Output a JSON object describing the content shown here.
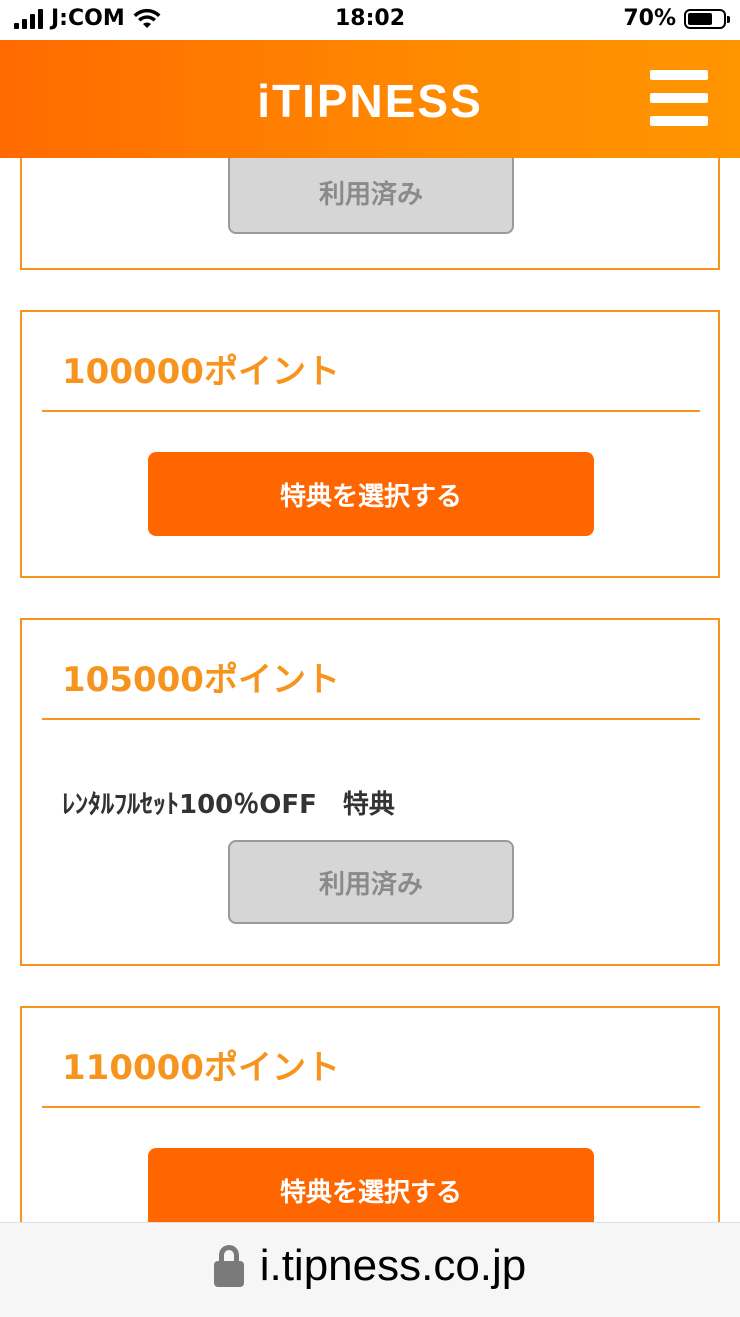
{
  "status_bar": {
    "carrier": "J:COM",
    "time": "18:02",
    "battery": "70%",
    "battery_level": 0.7
  },
  "header": {
    "logo": "iTIPNESS",
    "menu_icon": "hamburger-menu-icon"
  },
  "cards": [
    {
      "button_used": "利用済み"
    },
    {
      "title": "100000ポイント",
      "button_select": "特典を選択する"
    },
    {
      "title": "105000ポイント",
      "benefit": "ﾚﾝﾀﾙﾌﾙｾｯﾄ100％OFF　特典",
      "button_used": "利用済み"
    },
    {
      "title": "110000ポイント",
      "button_select": "特典を選択する"
    }
  ],
  "address_bar": {
    "url": "i.tipness.co.jp",
    "lock_icon": "lock-icon"
  },
  "colors": {
    "accent": "#ff6600",
    "border": "#f7941d",
    "disabled": "#d6d6d6"
  }
}
